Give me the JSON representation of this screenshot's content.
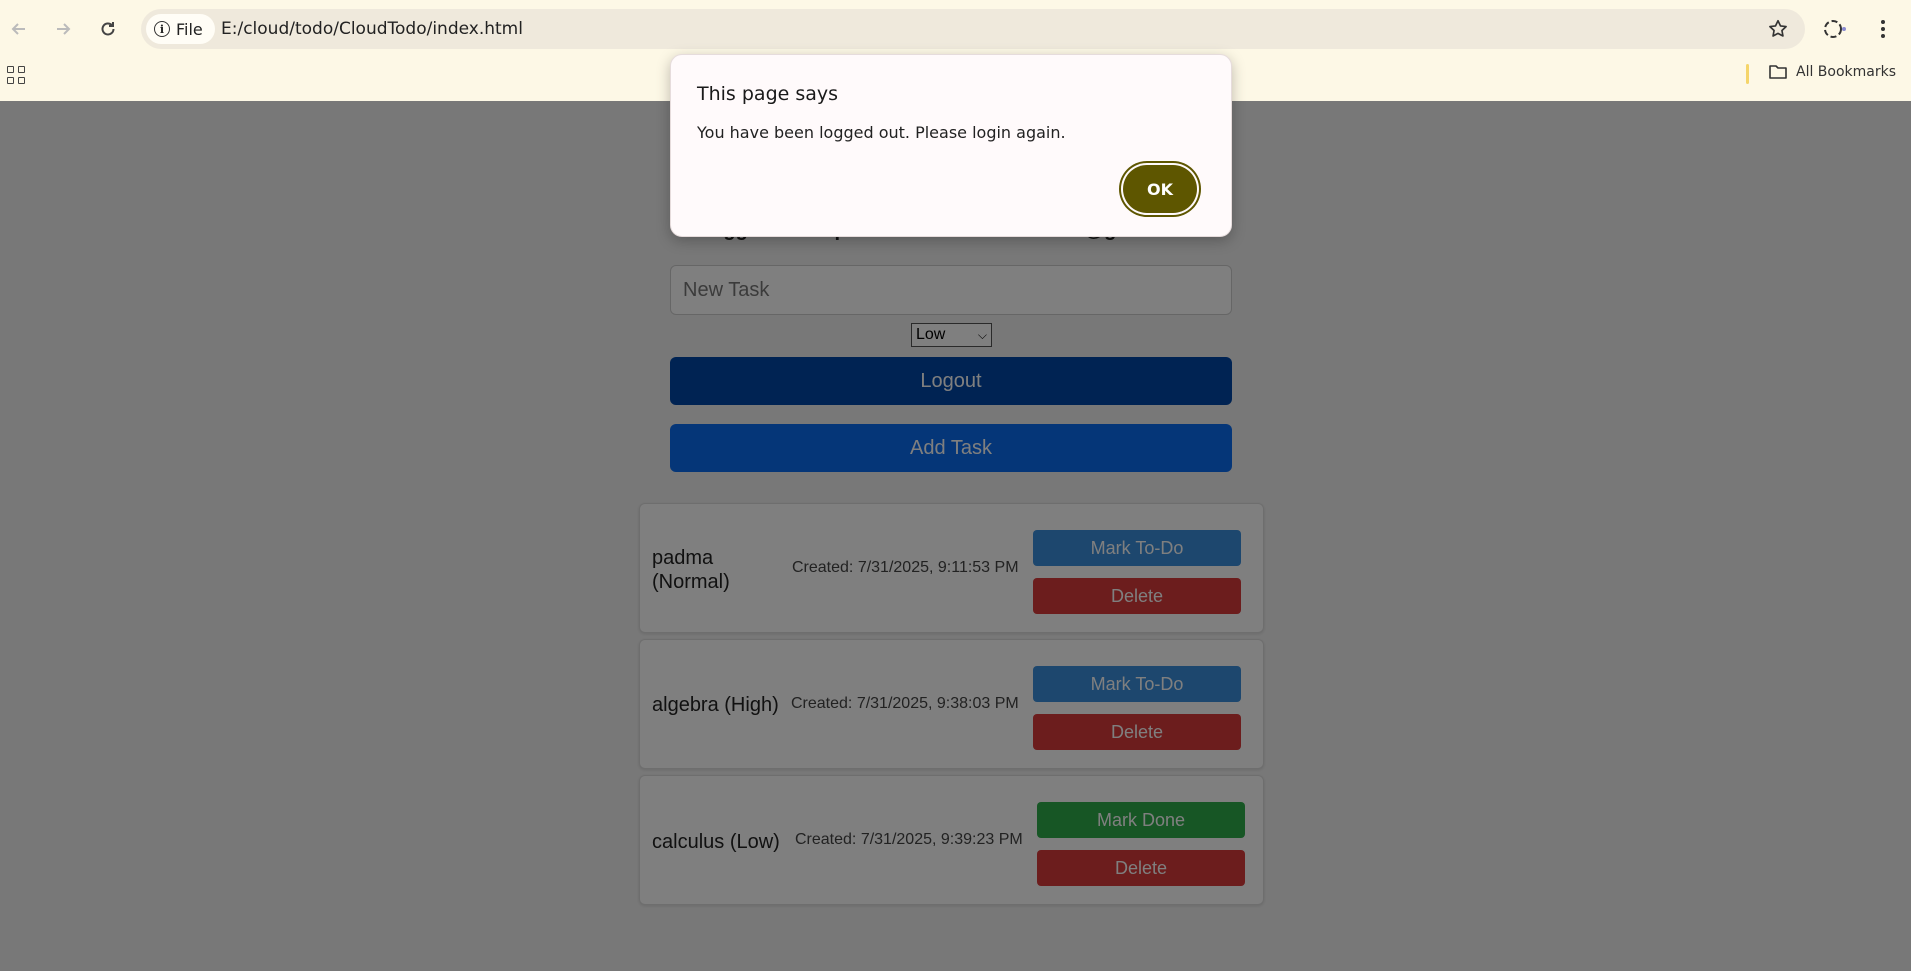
{
  "browser": {
    "file_chip_label": "File",
    "url": "E:/cloud/todo/CloudTodo/index.html",
    "bookmarks_label": "All Bookmarks"
  },
  "app": {
    "logged_in_text": "Logged in as: padmaloshanaasrinivasan@gmail.com",
    "task_placeholder": "New Task",
    "priority_selected": "Low",
    "logout_label": "Logout",
    "add_task_label": "Add Task",
    "tasks": [
      {
        "name": "padma (Normal)",
        "created": "Created: 7/31/2025, 9:11:53 PM",
        "action": "Mark To-Do",
        "delete": "Delete"
      },
      {
        "name": "algebra (High)",
        "created": "Created: 7/31/2025, 9:38:03 PM",
        "action": "Mark To-Do",
        "delete": "Delete"
      },
      {
        "name": "calculus (Low)",
        "created": "Created: 7/31/2025, 9:39:23 PM",
        "action": "Mark Done",
        "delete": "Delete"
      }
    ]
  },
  "dialog": {
    "title": "This page says",
    "message": "You have been logged out. Please login again.",
    "ok_label": "OK"
  },
  "colors": {
    "logout": "#0047a6",
    "add_task": "#0a6cf0",
    "mark_todo": "#3a8fdc",
    "mark_done": "#2fad4a",
    "delete": "#d83a3a",
    "ok_button": "#5e5600"
  }
}
